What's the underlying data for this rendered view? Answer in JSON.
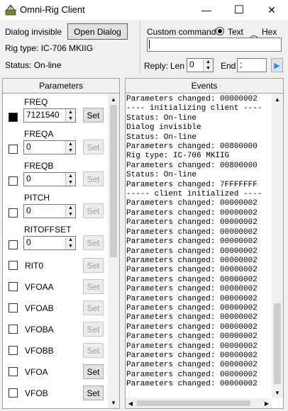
{
  "window": {
    "title": "Omni-Rig Client",
    "minimize": "—",
    "maximize": "☐",
    "close": "✕"
  },
  "top": {
    "dialog_status": "Dialog invisible",
    "open_dialog_label": "Open Dialog",
    "rig_type": "Rig type: IC-706 MKIIG",
    "status": "Status: On-line",
    "custom_command_label": "Custom command",
    "mode_text_label": "Text",
    "mode_hex_label": "Hex",
    "mode_selected": "Text",
    "command_value": "",
    "reply_label": "Reply:",
    "len_label": "Len",
    "len_value": "0",
    "end_label": "End",
    "end_value": ";"
  },
  "parameters": {
    "header": "Parameters",
    "set_label": "Set",
    "spin_params": [
      {
        "name": "FREQ",
        "value": "7121540",
        "checked": true,
        "set_enabled": true
      },
      {
        "name": "FREQA",
        "value": "0",
        "checked": false,
        "set_enabled": false
      },
      {
        "name": "FREQB",
        "value": "0",
        "checked": false,
        "set_enabled": false
      },
      {
        "name": "PITCH",
        "value": "0",
        "checked": false,
        "set_enabled": false
      },
      {
        "name": "RITOFFSET",
        "value": "0",
        "checked": false,
        "set_enabled": false
      }
    ],
    "flag_params": [
      {
        "name": "RIT0",
        "checked": false,
        "set_enabled": false
      },
      {
        "name": "VFOAA",
        "checked": false,
        "set_enabled": false
      },
      {
        "name": "VFOAB",
        "checked": false,
        "set_enabled": false
      },
      {
        "name": "VFOBA",
        "checked": false,
        "set_enabled": false
      },
      {
        "name": "VFOBB",
        "checked": false,
        "set_enabled": false
      },
      {
        "name": "VFOA",
        "checked": false,
        "set_enabled": true
      },
      {
        "name": "VFOB",
        "checked": false,
        "set_enabled": true
      }
    ]
  },
  "events": {
    "header": "Events",
    "lines": [
      "Parameters changed: 00000002",
      "---- initializing client ----",
      "Status: On-line",
      "Dialog invisible",
      "Status: On-line",
      "Parameters changed: 00800000",
      "Rig type: IC-706 MKIIG",
      "Parameters changed: 00800000",
      "Status: On-line",
      "Parameters changed: 7FFFFFFF",
      "----- client initialized ----",
      "Parameters changed: 00000002",
      "Parameters changed: 00000002",
      "Parameters changed: 00000002",
      "Parameters changed: 00000002",
      "Parameters changed: 00000002",
      "Parameters changed: 00000002",
      "Parameters changed: 00000002",
      "Parameters changed: 00000002",
      "Parameters changed: 00000002",
      "Parameters changed: 00000002",
      "Parameters changed: 00000002",
      "Parameters changed: 00000002",
      "Parameters changed: 00000002",
      "Parameters changed: 00000002",
      "Parameters changed: 00000002",
      "Parameters changed: 00000002",
      "Parameters changed: 00000002",
      "Parameters changed: 00000002",
      "Parameters changed: 00000002",
      "Parameters changed: 00000002"
    ]
  },
  "icons": {
    "app": "omnirig-app-icon",
    "run": "play-arrow-icon"
  },
  "colors": {
    "accent": "#0078d7",
    "run_arrow": "#1e90ff"
  }
}
